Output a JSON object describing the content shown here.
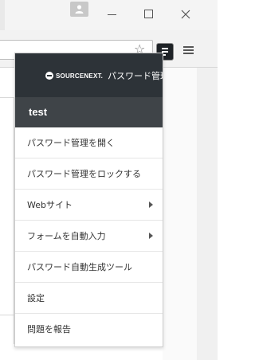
{
  "popup": {
    "brand": "SOURCENEXT.",
    "product": "パスワード管理",
    "user": "test",
    "items": [
      {
        "label": "パスワード管理を開く",
        "submenu": false
      },
      {
        "label": "パスワード管理をロックする",
        "submenu": false
      },
      {
        "label": "Webサイト",
        "submenu": true
      },
      {
        "label": "フォームを自動入力",
        "submenu": true
      },
      {
        "label": "パスワード自動生成ツール",
        "submenu": false
      },
      {
        "label": "設定",
        "submenu": false
      },
      {
        "label": "問題を報告",
        "submenu": false
      }
    ]
  },
  "toolbar": {
    "star_icon": "☆"
  }
}
